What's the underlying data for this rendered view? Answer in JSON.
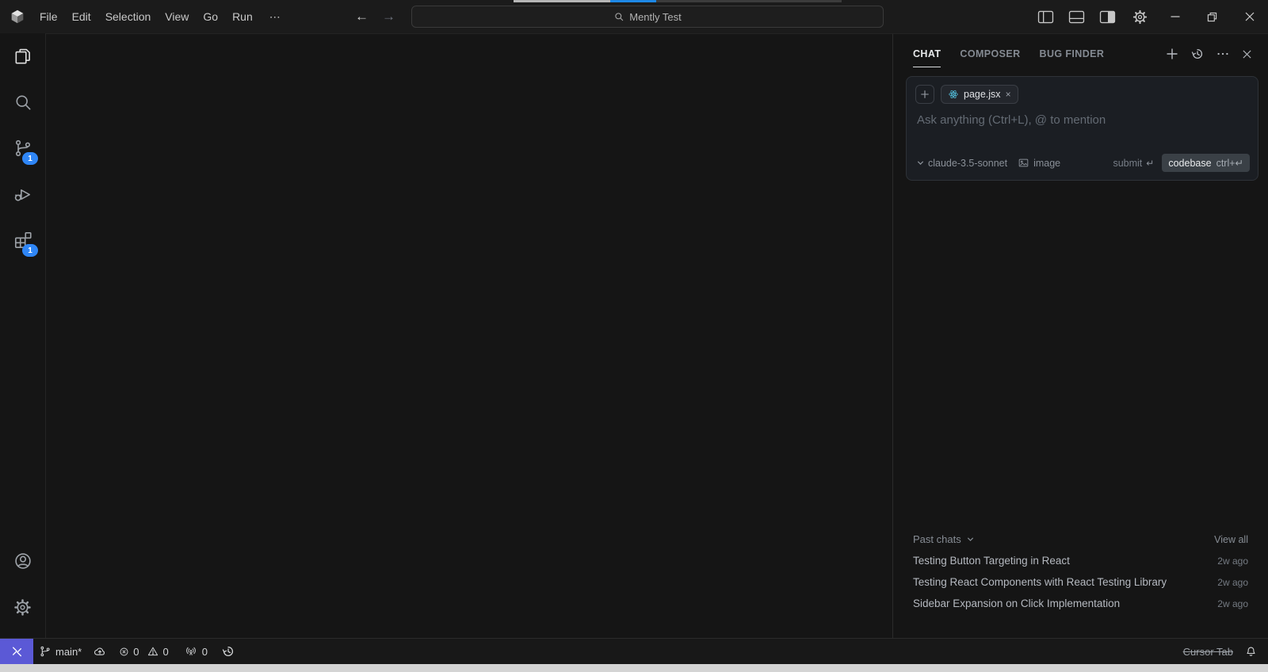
{
  "titlebar": {
    "menus": [
      "File",
      "Edit",
      "Selection",
      "View",
      "Go",
      "Run"
    ],
    "overflow_label": "⋯",
    "search": "Mently Test"
  },
  "activity": {
    "scm_badge": "1",
    "extensions_badge": "1"
  },
  "chat": {
    "tabs": [
      "CHAT",
      "COMPOSER",
      "BUG FINDER"
    ],
    "more_label": "⋯",
    "chip_file": "page.jsx",
    "chip_close": "×",
    "placeholder": "Ask anything (Ctrl+L), @ to mention",
    "model": "claude-3.5-sonnet",
    "image_label": "image",
    "submit_label": "submit",
    "submit_key": "↵",
    "codebase_label": "codebase",
    "codebase_key": "ctrl+↵"
  },
  "past_chats": {
    "header": "Past chats",
    "view_all": "View all",
    "items": [
      {
        "title": "Testing Button Targeting in React",
        "time": "2w ago"
      },
      {
        "title": "Testing React Components with React Testing Library",
        "time": "2w ago"
      },
      {
        "title": "Sidebar Expansion on Click Implementation",
        "time": "2w ago"
      }
    ]
  },
  "statusbar": {
    "branch": "main*",
    "errors": "0",
    "warnings": "0",
    "ports": "0",
    "cursor_tab": "Cursor Tab"
  },
  "colors": {
    "badge_blue": "#2f86f6",
    "remote_indigo": "#5b59d6",
    "react_blue": "#53c1de",
    "progress_blue": "#1e88e5"
  }
}
